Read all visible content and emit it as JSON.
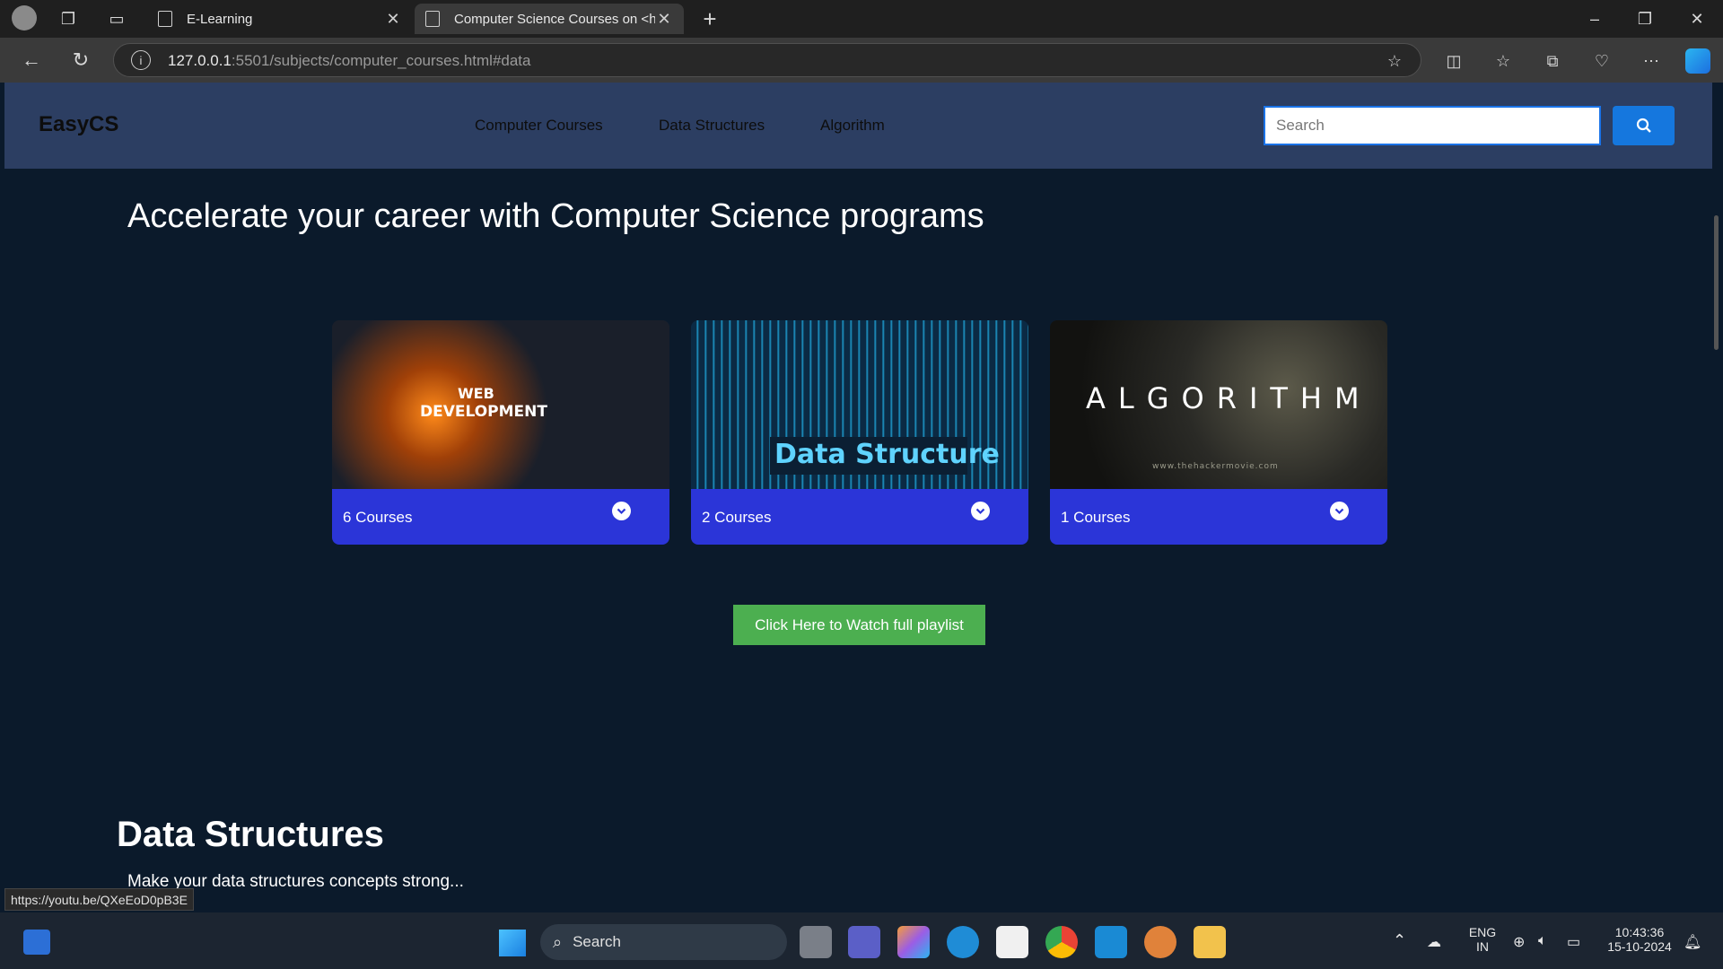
{
  "browser": {
    "tabs": [
      {
        "label": "E-Learning"
      },
      {
        "label": "Computer Science Courses on <h"
      }
    ],
    "new_tab": "+",
    "url_host": "127.0.0.1",
    "url_rest": ":5501/subjects/computer_courses.html#data"
  },
  "navbar": {
    "brand": "EasyCS",
    "links": [
      {
        "label": "Computer Courses"
      },
      {
        "label": "Data Structures"
      },
      {
        "label": "Algorithm"
      }
    ],
    "search_placeholder": "Search"
  },
  "main": {
    "headline": "Accelerate your career with Computer Science programs",
    "cards": [
      {
        "image_text_line1": "WEB",
        "image_text_line2": "DEVELOPMENT",
        "count_label": "6 Courses"
      },
      {
        "image_text": "Data Structure",
        "count_label": "2 Courses"
      },
      {
        "image_text": "ALGORITHM",
        "image_subtext": "www.thehackermovie.com",
        "count_label": "1 Courses"
      }
    ],
    "cta_label": "Click Here to Watch full playlist",
    "section_title": "Data Structures",
    "section_subtitle": "Make your data structures concepts strong..."
  },
  "status_link": "https://youtu.be/QXeEoD0pB3E",
  "taskbar": {
    "search_label": "Search",
    "lang_line1": "ENG",
    "lang_line2": "IN",
    "time": "10:43:36",
    "date": "15-10-2024"
  },
  "colors": {
    "page_bg": "#0b1a2b",
    "navbar_bg": "#2c3e62",
    "card_footer": "#2b35d8",
    "cta_green": "#4caf50",
    "search_button": "#1577de"
  }
}
